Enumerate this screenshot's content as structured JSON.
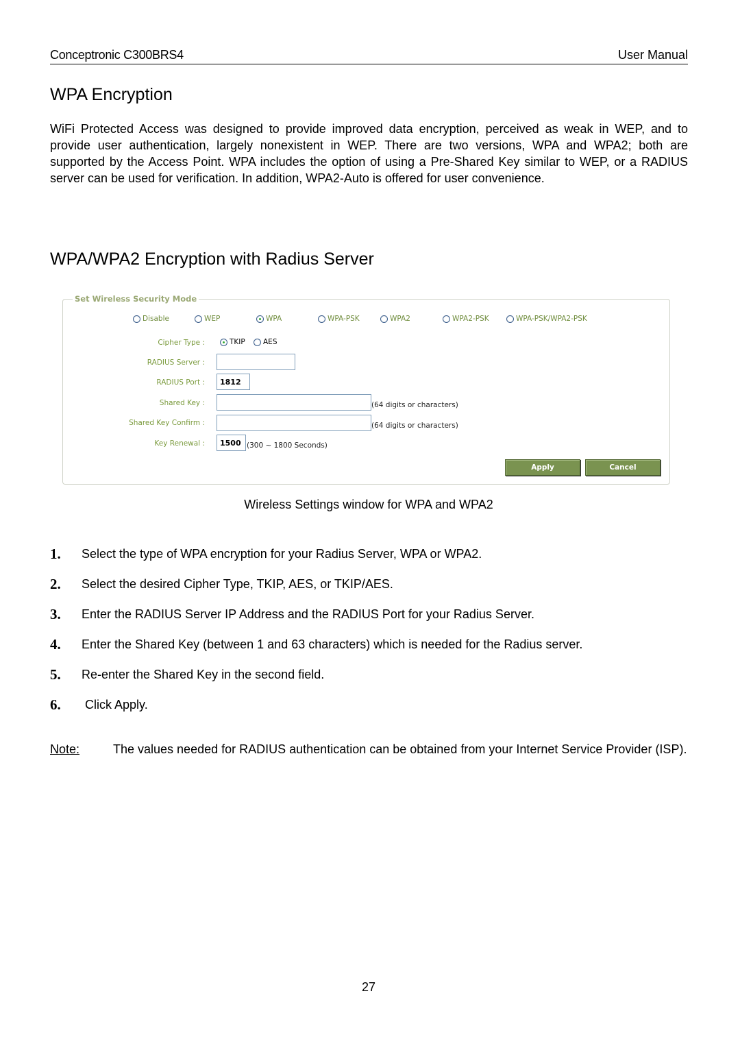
{
  "header": {
    "product": "Conceptronic C300BRS4",
    "doc_type": "User Manual"
  },
  "section1": {
    "title": "WPA Encryption",
    "body": "WiFi Protected Access was designed to provide improved data encryption, perceived as weak in WEP, and to provide user authentication, largely nonexistent in WEP. There are two versions, WPA and WPA2; both are supported by the Access Point. WPA includes the option of using a Pre-Shared Key similar to WEP, or a RADIUS server can be used for verification. In addition, WPA2-Auto is offered for user convenience."
  },
  "section2": {
    "title": "WPA/WPA2 Encryption with Radius Server"
  },
  "ui": {
    "legend": "Set Wireless Security Mode",
    "modes": [
      {
        "label": "Disable",
        "selected": false
      },
      {
        "label": "WEP",
        "selected": false
      },
      {
        "label": "WPA",
        "selected": true
      },
      {
        "label": "WPA-PSK",
        "selected": false
      },
      {
        "label": "WPA2",
        "selected": false
      },
      {
        "label": "WPA2-PSK",
        "selected": false
      },
      {
        "label": "WPA-PSK/WPA2-PSK",
        "selected": false
      }
    ],
    "cipher_label": "Cipher Type :",
    "cipher_options": [
      {
        "label": "TKIP",
        "selected": true
      },
      {
        "label": "AES",
        "selected": false
      }
    ],
    "radius_server_label": "RADIUS Server :",
    "radius_server_value": "",
    "radius_port_label": "RADIUS Port :",
    "radius_port_value": "1812",
    "shared_key_label": "Shared Key :",
    "shared_key_value": "",
    "shared_key_hint": "(64 digits or characters)",
    "shared_key_confirm_label": "Shared Key Confirm :",
    "shared_key_confirm_value": "",
    "shared_key_confirm_hint": "(64 digits or characters)",
    "key_renewal_label": "Key Renewal :",
    "key_renewal_value": "1500",
    "key_renewal_hint": "(300 ~ 1800 Seconds)",
    "apply_label": "Apply",
    "cancel_label": "Cancel",
    "colors": {
      "button_green": "#7a9350",
      "label_green": "#7a9a3c",
      "legend_green": "#9aa874"
    }
  },
  "caption": "Wireless Settings window for WPA and WPA2",
  "steps": [
    {
      "num": "1.",
      "text": "Select the type of WPA encryption for your Radius Server, WPA or WPA2."
    },
    {
      "num": "2.",
      "text": "Select the desired Cipher Type, TKIP, AES, or TKIP/AES."
    },
    {
      "num": "3.",
      "text": "Enter the RADIUS Server IP Address and the RADIUS Port for your Radius Server."
    },
    {
      "num": "4.",
      "text": "Enter the Shared Key (between 1 and 63 characters) which is needed for the Radius server."
    },
    {
      "num": "5.",
      "text": "Re-enter the Shared Key in the second field."
    },
    {
      "num": "6.",
      "text": " Click Apply."
    }
  ],
  "note": {
    "label": "Note:",
    "text": "The values needed for RADIUS authentication can be obtained from your Internet Service Provider (ISP)."
  },
  "page_number": "27"
}
